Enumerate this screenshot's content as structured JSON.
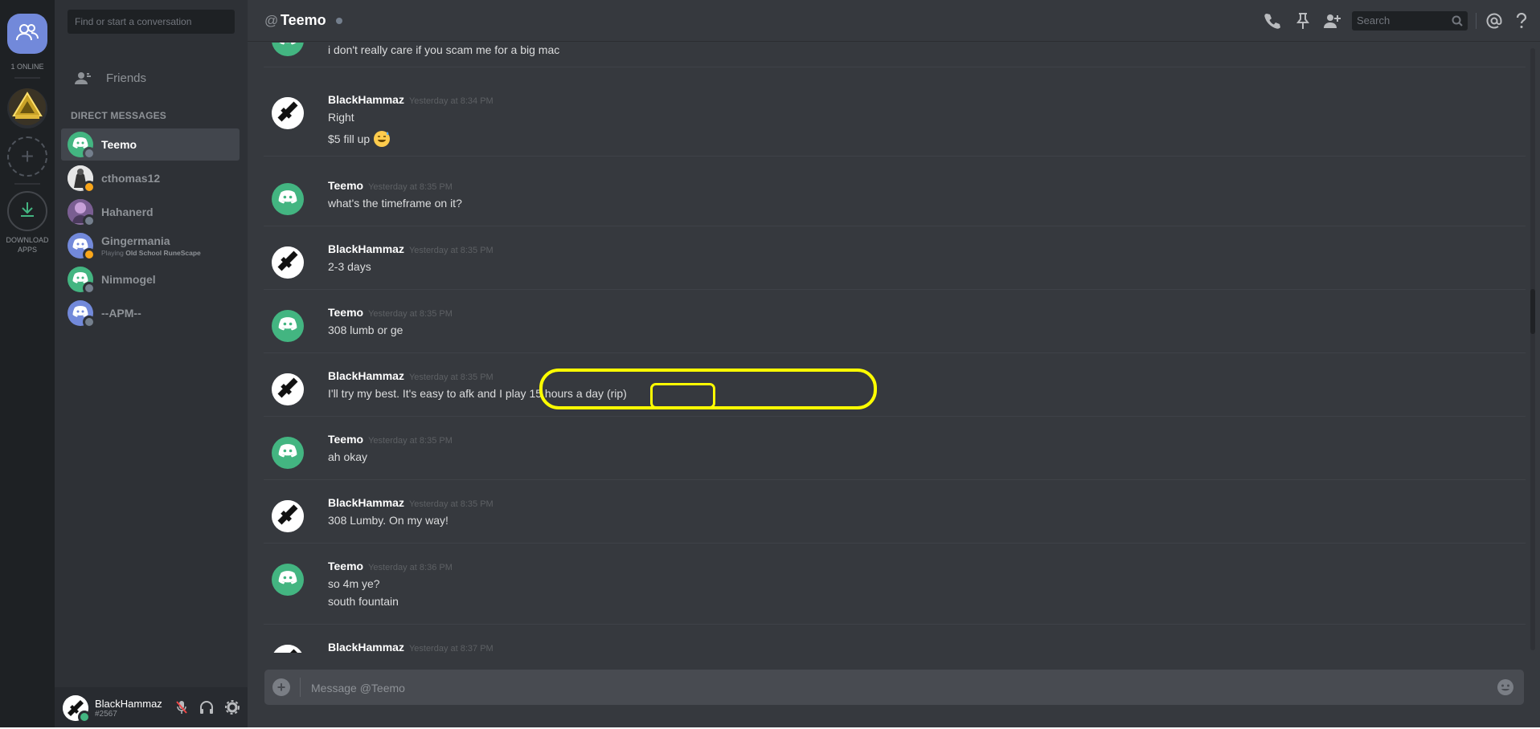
{
  "guilds": {
    "online_count": "1 ONLINE",
    "add_label": "+",
    "download_label_1": "DOWNLOAD",
    "download_label_2": "APPS"
  },
  "sidebar": {
    "search_placeholder": "Find or start a conversation",
    "friends_label": "Friends",
    "dm_header": "DIRECT MESSAGES",
    "dms": [
      {
        "name": "Teemo",
        "status": "offline",
        "avatar_color": "#43b581"
      },
      {
        "name": "cthomas12",
        "status": "idle",
        "avatar_color": "#ffffff"
      },
      {
        "name": "Hahanerd",
        "status": "offline",
        "avatar_color": "#8a6f9e"
      },
      {
        "name": "Gingermania",
        "status": "idle",
        "avatar_color": "#7289da",
        "activity_prefix": "Playing",
        "activity_game": "Old School RuneScape"
      },
      {
        "name": "Nimmogel",
        "status": "offline",
        "avatar_color": "#43b581"
      },
      {
        "name": "--APM--",
        "status": "offline",
        "avatar_color": "#7289da"
      }
    ]
  },
  "user_panel": {
    "username": "BlackHammaz",
    "discriminator": "#2567"
  },
  "topbar": {
    "at_symbol": "@",
    "channel_name": "Teemo",
    "search_placeholder": "Search"
  },
  "messages": [
    {
      "author": "",
      "time": "",
      "lines": [
        "i don't really care if you scam me for a big mac"
      ],
      "avatar": "teemo"
    },
    {
      "author": "BlackHammaz",
      "time": "Yesterday at 8:34 PM",
      "lines": [
        "Right",
        "$5 fill up"
      ],
      "avatar": "hammaz"
    },
    {
      "author": "Teemo",
      "time": "Yesterday at 8:35 PM",
      "lines": [
        "what's the timeframe on it?"
      ],
      "avatar": "teemo"
    },
    {
      "author": "BlackHammaz",
      "time": "Yesterday at 8:35 PM",
      "lines": [
        "2-3 days"
      ],
      "avatar": "hammaz"
    },
    {
      "author": "Teemo",
      "time": "Yesterday at 8:35 PM",
      "lines": [
        "308 lumb or ge"
      ],
      "avatar": "teemo"
    },
    {
      "author": "BlackHammaz",
      "time": "Yesterday at 8:35 PM",
      "lines": [
        "I'll try my best. It's easy to afk and I play 15 hours a day (rip)"
      ],
      "avatar": "hammaz"
    },
    {
      "author": "Teemo",
      "time": "Yesterday at 8:35 PM",
      "lines": [
        "ah okay"
      ],
      "avatar": "teemo"
    },
    {
      "author": "BlackHammaz",
      "time": "Yesterday at 8:35 PM",
      "lines": [
        "308 Lumby. On my way!"
      ],
      "avatar": "hammaz"
    },
    {
      "author": "Teemo",
      "time": "Yesterday at 8:36 PM",
      "lines": [
        "so 4m ye?",
        "south fountain"
      ],
      "avatar": "teemo"
    },
    {
      "author": "BlackHammaz",
      "time": "Yesterday at 8:37 PM",
      "lines": [],
      "avatar": "hammaz"
    }
  ],
  "composer": {
    "placeholder": "Message @Teemo",
    "plus_label": "+"
  },
  "colors": {
    "teemo_green": "#43b581",
    "blurple": "#7289da",
    "idle": "#faa61a",
    "offline": "#747f8d",
    "online": "#43b581",
    "highlight": "#ffff00"
  }
}
